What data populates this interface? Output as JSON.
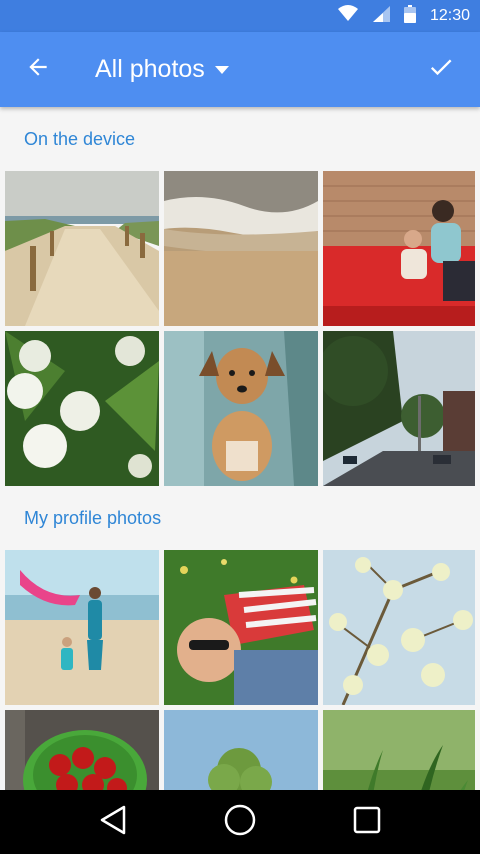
{
  "status": {
    "time": "12:30"
  },
  "app_bar": {
    "title": "All photos"
  },
  "sections": [
    {
      "title": "On the device"
    },
    {
      "title": "My profile photos"
    }
  ],
  "colors": {
    "accent": "#4e8ef1",
    "status_bar": "#3f7ee0",
    "section_text": "#2f86d6"
  },
  "photos_device": [
    "beach-path",
    "sand-waves",
    "mother-child-red-sofa",
    "white-flowers",
    "dog",
    "city-street"
  ],
  "photos_profile": [
    "kids-beach-scarf",
    "boy-grass-sunglasses",
    "blossom-branch",
    "cherries-bowl",
    "tree-sky",
    "grass-blades"
  ]
}
